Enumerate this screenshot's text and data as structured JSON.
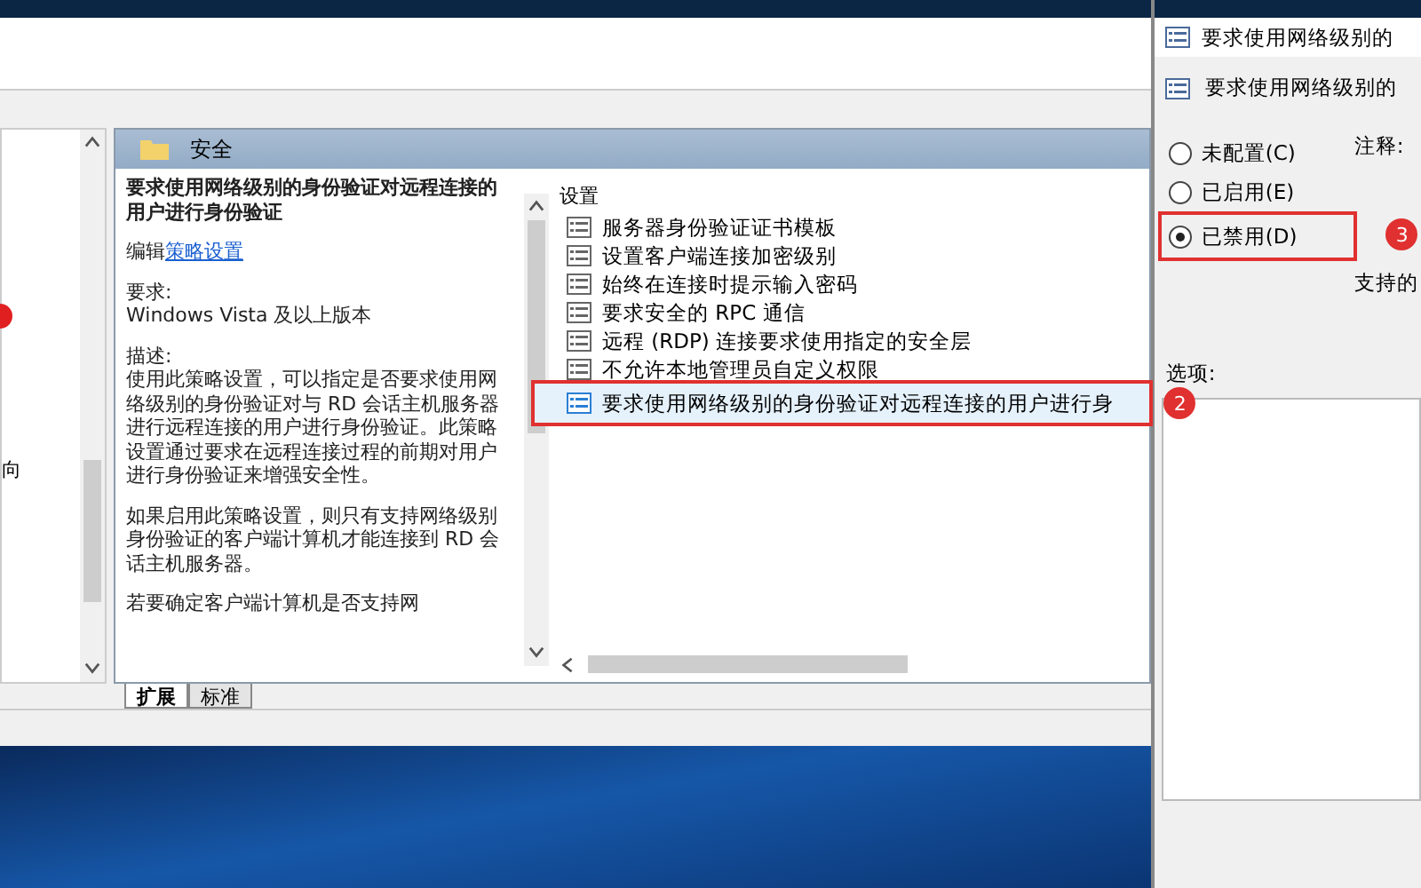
{
  "tree_pane": {
    "fragments": [
      "向"
    ],
    "callout_dot": true
  },
  "category": {
    "title": "安全"
  },
  "description": {
    "title": "要求使用网络级别的身份验证对远程连接的用户进行身份验证",
    "edit_prefix": "编辑",
    "edit_link": "策略设置",
    "requirement_label": "要求:",
    "requirement": "Windows Vista 及以上版本",
    "description_label": "描述:",
    "paragraphs": [
      "使用此策略设置，可以指定是否要求使用网络级别的身份验证对与 RD 会话主机服务器进行远程连接的用户进行身份验证。此策略设置通过要求在远程连接过程的前期对用户进行身份验证来增强安全性。",
      "如果启用此策略设置，则只有支持网络级别身份验证的客户端计算机才能连接到 RD 会话主机服务器。",
      "若要确定客户端计算机是否支持网"
    ]
  },
  "settings": {
    "heading": "设置",
    "items": [
      {
        "label": "服务器身份验证证书模板",
        "selected": false,
        "highlighted": false
      },
      {
        "label": "设置客户端连接加密级别",
        "selected": false,
        "highlighted": false
      },
      {
        "label": "始终在连接时提示输入密码",
        "selected": false,
        "highlighted": false
      },
      {
        "label": "要求安全的 RPC 通信",
        "selected": false,
        "highlighted": false
      },
      {
        "label": "远程 (RDP) 连接要求使用指定的安全层",
        "selected": false,
        "highlighted": false
      },
      {
        "label": "不允许本地管理员自定义权限",
        "selected": false,
        "highlighted": false
      },
      {
        "label": "要求使用网络级别的身份验证对远程连接的用户进行身",
        "selected": true,
        "highlighted": true,
        "callout": "2"
      }
    ]
  },
  "tabs": [
    {
      "label": "扩展",
      "selected": true
    },
    {
      "label": "标准",
      "selected": false
    }
  ],
  "dialog": {
    "title": "要求使用网络级别的",
    "subtitle": "要求使用网络级别的",
    "comment_label": "注释:",
    "supported_label": "支持的",
    "options_label": "选项:",
    "options": [
      {
        "label": "未配置(C)",
        "selected": false,
        "highlighted": false
      },
      {
        "label": "已启用(E)",
        "selected": false,
        "highlighted": false
      },
      {
        "label": "已禁用(D)",
        "selected": true,
        "highlighted": true,
        "callout": "3"
      }
    ]
  }
}
